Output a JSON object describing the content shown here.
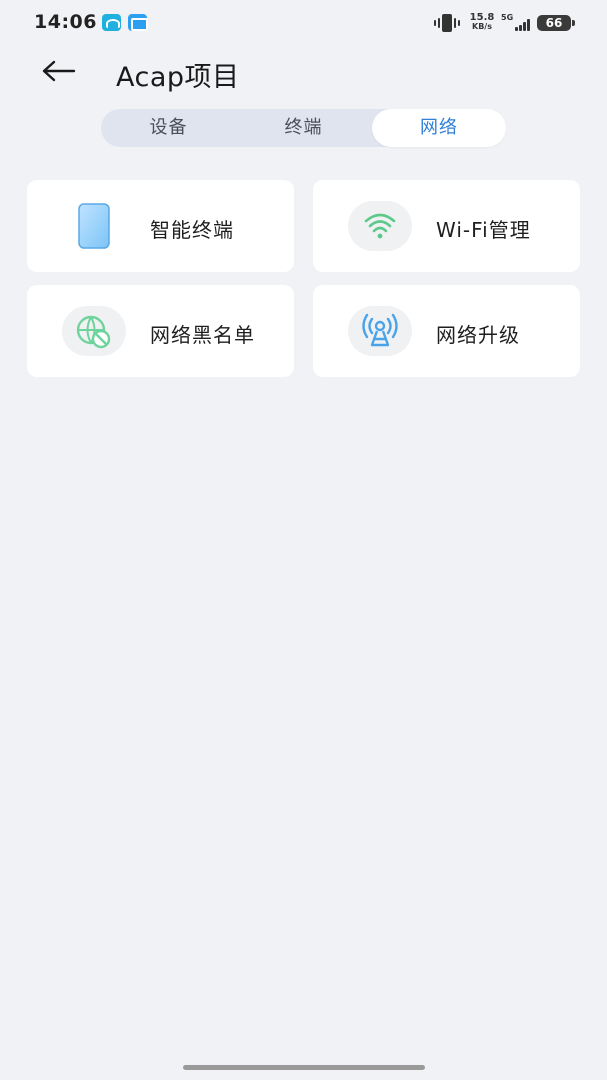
{
  "status_bar": {
    "time": "14:06",
    "net_speed_value": "15.8",
    "net_speed_unit": "KB/s",
    "network_gen": "5G",
    "battery": "66"
  },
  "header": {
    "title": "Acap项目"
  },
  "tabs": [
    {
      "label": "设备",
      "selected": false
    },
    {
      "label": "终端",
      "selected": false
    },
    {
      "label": "网络",
      "selected": true
    }
  ],
  "cards": [
    {
      "label": "智能终端",
      "icon": "phone-icon"
    },
    {
      "label": "Wi-Fi管理",
      "icon": "wifi-icon"
    },
    {
      "label": "网络黑名单",
      "icon": "globe-block-icon"
    },
    {
      "label": "网络升级",
      "icon": "antenna-icon"
    }
  ],
  "colors": {
    "accent": "#2f7fd6",
    "background": "#f1f2f6",
    "tab_track": "#dfe4ef",
    "green_icon": "#5cc98a",
    "blue_icon": "#4aa3e8"
  }
}
